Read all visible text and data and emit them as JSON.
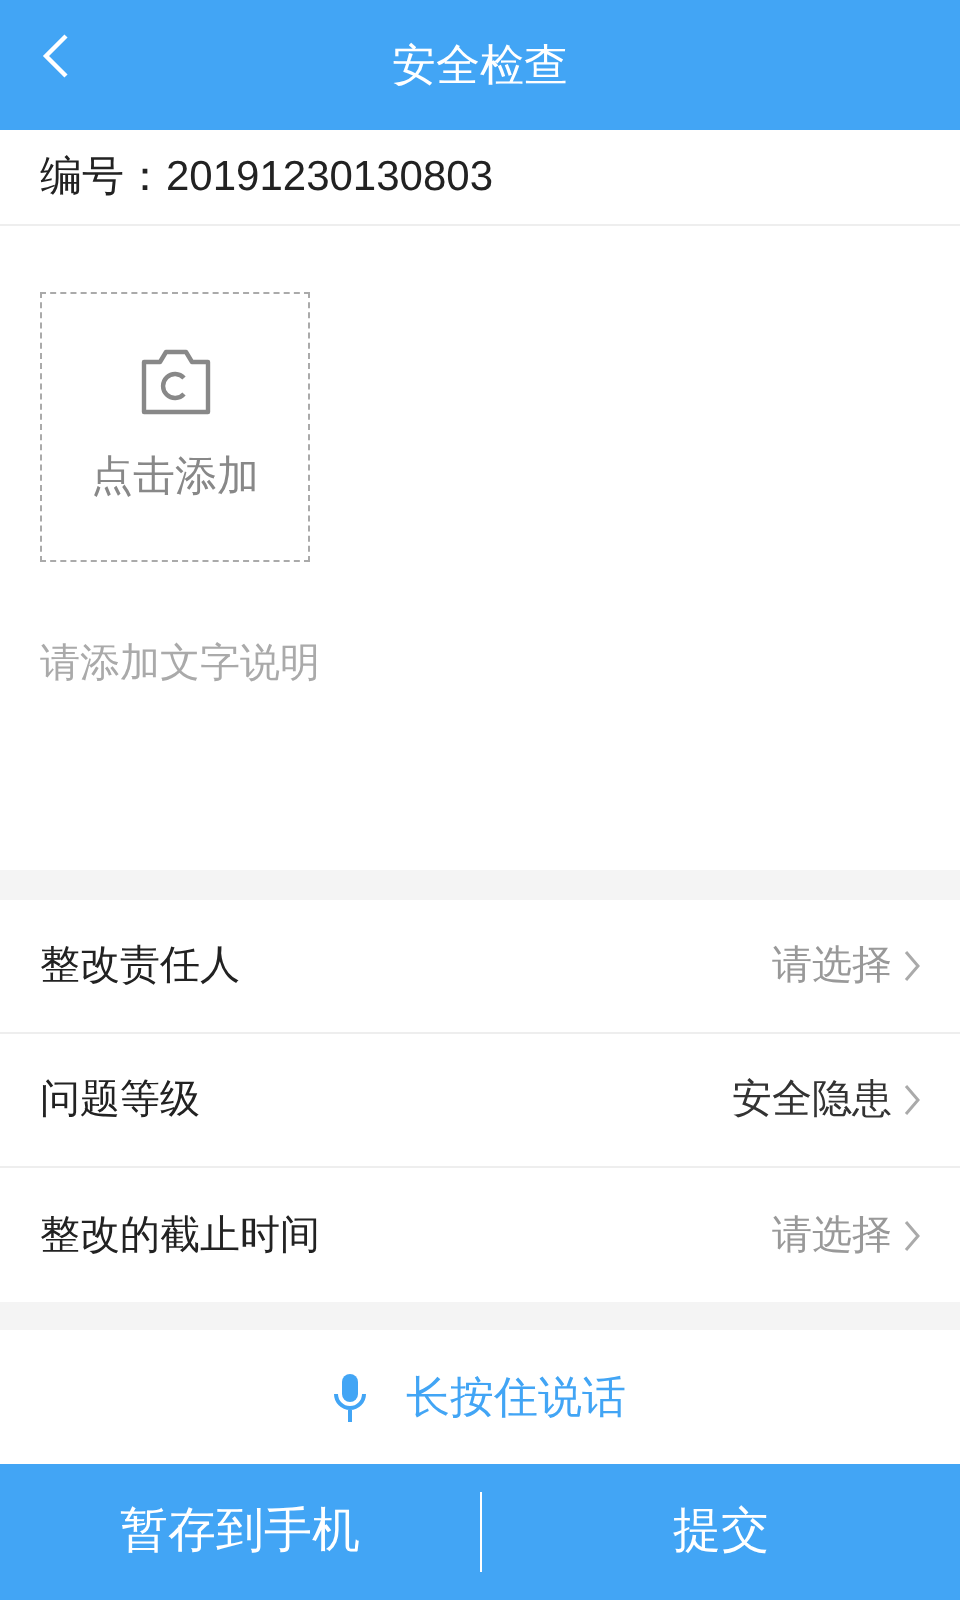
{
  "header": {
    "title": "安全检查"
  },
  "serial": {
    "label": "编号：",
    "value": "20191230130803"
  },
  "photo_upload": {
    "label": "点击添加"
  },
  "description": {
    "placeholder": "请添加文字说明"
  },
  "fields": [
    {
      "label": "整改责任人",
      "placeholder": "请选择"
    },
    {
      "label": "问题等级",
      "value": "安全隐患"
    },
    {
      "label": "整改的截止时间",
      "placeholder": "请选择"
    }
  ],
  "voice": {
    "label": "长按住说话"
  },
  "buttons": [
    "暂存到手机",
    "提交"
  ]
}
